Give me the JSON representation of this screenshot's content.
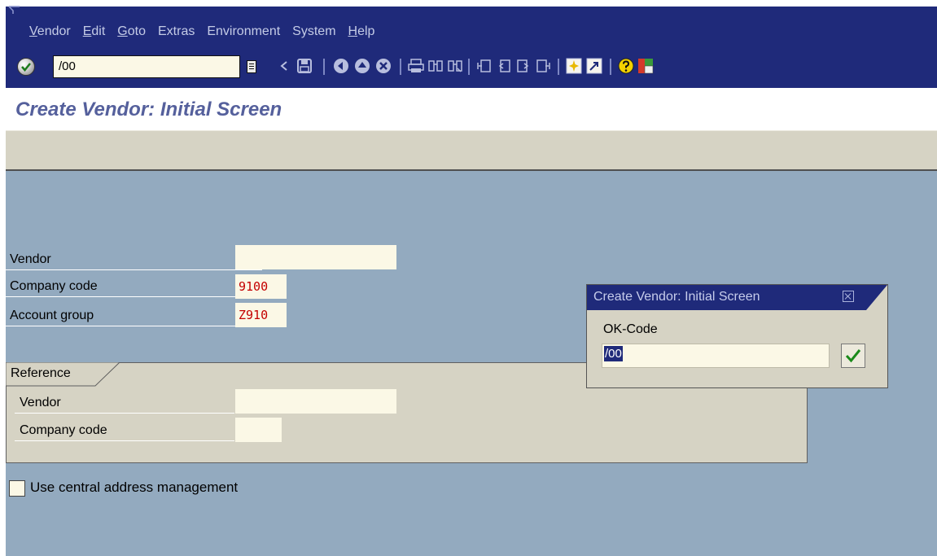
{
  "menu": {
    "items": [
      {
        "mn": "V",
        "rest": "endor"
      },
      {
        "mn": "E",
        "rest": "dit"
      },
      {
        "mn": "G",
        "rest": "oto"
      },
      {
        "mn": "",
        "rest": "Extras"
      },
      {
        "mn": "",
        "rest": "Environment"
      },
      {
        "mn": "",
        "rest": "System"
      },
      {
        "mn": "H",
        "rest": "elp"
      }
    ]
  },
  "toolbar": {
    "command_value": "/00",
    "icons": [
      "enter-icon",
      "back-arrow-icon",
      "save-icon",
      "back-icon",
      "exit-icon",
      "cancel-icon",
      "print-icon",
      "find-icon",
      "find-next-icon",
      "first-page-icon",
      "previous-page-icon",
      "next-page-icon",
      "last-page-icon",
      "create-session-icon",
      "shortcut-icon",
      "help-icon",
      "layout-icon"
    ]
  },
  "page": {
    "title": "Create Vendor: Initial Screen"
  },
  "fields": {
    "vendor_label": "Vendor",
    "vendor_value": "",
    "company_code_label": "Company code",
    "company_code_value": "9100",
    "account_group_label": "Account group",
    "account_group_value": "Z910"
  },
  "reference": {
    "tab_label": "Reference",
    "vendor_label": "Vendor",
    "vendor_value": "",
    "company_code_label": "Company code",
    "company_code_value": ""
  },
  "checkbox": {
    "label": "Use central address management",
    "checked": false
  },
  "popup": {
    "title": "Create Vendor: Initial Screen",
    "ok_label": "OK-Code",
    "ok_value": "/00"
  },
  "colors": {
    "title_bar": "#1f2a7a",
    "content_bg": "#93aabf",
    "panel_bg": "#d6d3c4",
    "field_bg": "#fbf8e6",
    "title_text": "#55609c",
    "value_red": "#c40000"
  }
}
